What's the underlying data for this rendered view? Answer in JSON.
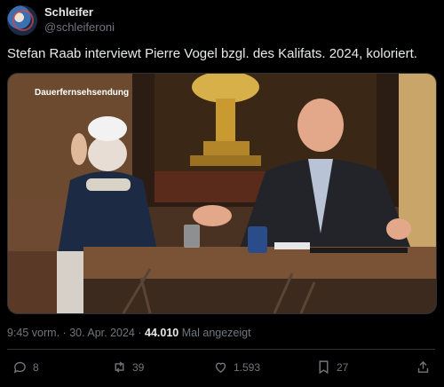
{
  "author": {
    "name": "Schleifer",
    "handle": "@schleiferoni"
  },
  "tweet": {
    "text": "Stefan Raab interviewt Pierre Vogel bzgl. des Kalifats. 2024, koloriert.",
    "media_caption": "Dauerfernsehsendung"
  },
  "meta": {
    "time": "9:45 vorm.",
    "separator": "·",
    "date": "30. Apr. 2024",
    "views_count": "44.010",
    "views_label": "Mal angezeigt"
  },
  "actions": {
    "replies": "8",
    "reposts": "39",
    "likes": "1.593",
    "bookmarks": "27"
  },
  "icons": [
    "reply-icon",
    "repost-icon",
    "like-icon",
    "bookmark-icon",
    "share-icon"
  ]
}
